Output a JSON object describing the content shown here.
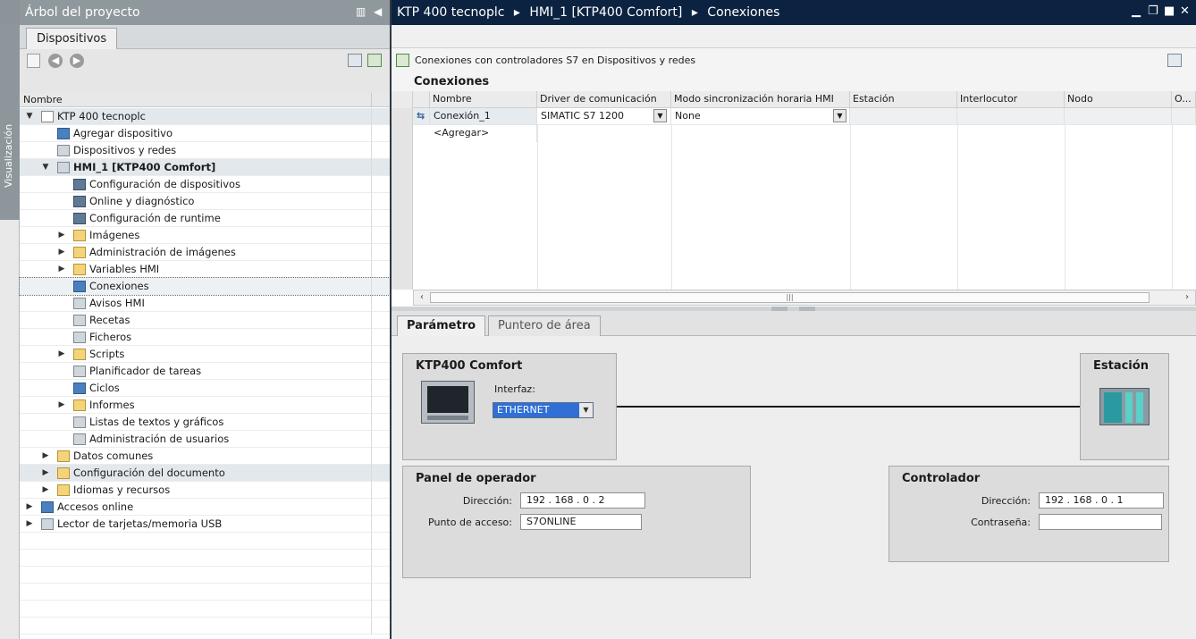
{
  "side_tab": {
    "label": "Visualización"
  },
  "left_panel": {
    "title": "Árbol del proyecto",
    "tab": "Dispositivos",
    "column_header": "Nombre",
    "tree": [
      {
        "label": "KTP 400 tecnoplc",
        "level": 0,
        "expanded": true,
        "icon": "page-icon"
      },
      {
        "label": "Agregar dispositivo",
        "level": 1,
        "icon": "add-device-icon"
      },
      {
        "label": "Dispositivos y redes",
        "level": 1,
        "icon": "network-icon"
      },
      {
        "label": "HMI_1 [KTP400 Comfort]",
        "level": 1,
        "expanded": true,
        "icon": "hmi-icon"
      },
      {
        "label": "Configuración de dispositivos",
        "level": 2,
        "icon": "device-config-icon"
      },
      {
        "label": "Online y diagnóstico",
        "level": 2,
        "icon": "diagnostics-icon"
      },
      {
        "label": "Configuración de runtime",
        "level": 2,
        "icon": "runtime-icon"
      },
      {
        "label": "Imágenes",
        "level": 2,
        "collapsed": true,
        "icon": "folder-icon"
      },
      {
        "label": "Administración de imágenes",
        "level": 2,
        "collapsed": true,
        "icon": "folder-icon"
      },
      {
        "label": "Variables HMI",
        "level": 2,
        "collapsed": true,
        "icon": "folder-icon"
      },
      {
        "label": "Conexiones",
        "level": 2,
        "icon": "connections-icon",
        "selected": true
      },
      {
        "label": "Avisos HMI",
        "level": 2,
        "icon": "alarm-icon"
      },
      {
        "label": "Recetas",
        "level": 2,
        "icon": "recipe-icon"
      },
      {
        "label": "Ficheros",
        "level": 2,
        "icon": "archive-icon"
      },
      {
        "label": "Scripts",
        "level": 2,
        "collapsed": true,
        "icon": "folder-icon"
      },
      {
        "label": "Planificador de tareas",
        "level": 2,
        "icon": "scheduler-icon"
      },
      {
        "label": "Ciclos",
        "level": 2,
        "icon": "cycle-icon"
      },
      {
        "label": "Informes",
        "level": 2,
        "collapsed": true,
        "icon": "folder-icon"
      },
      {
        "label": "Listas de textos y gráficos",
        "level": 2,
        "icon": "text-list-icon"
      },
      {
        "label": "Administración de usuarios",
        "level": 2,
        "icon": "users-icon"
      },
      {
        "label": "Datos comunes",
        "level": 1,
        "collapsed": true,
        "icon": "folder-icon"
      },
      {
        "label": "Configuración del documento",
        "level": 1,
        "collapsed": true,
        "icon": "folder-icon"
      },
      {
        "label": "Idiomas y recursos",
        "level": 1,
        "collapsed": true,
        "icon": "folder-icon"
      },
      {
        "label": "Accesos online",
        "level": 0,
        "collapsed": true,
        "icon": "online-icon"
      },
      {
        "label": "Lector de tarjetas/memoria USB",
        "level": 0,
        "collapsed": true,
        "icon": "usb-icon"
      }
    ]
  },
  "editor": {
    "breadcrumb": [
      "KTP 400 tecnoplc",
      "HMI_1 [KTP400 Comfort]",
      "Conexiones"
    ],
    "toolbar_text": "Conexiones con controladores S7 en Dispositivos y redes",
    "section_title": "Conexiones",
    "columns": [
      "Nombre",
      "Driver de comunicación",
      "Modo sincronización horaria HMI",
      "Estación",
      "Interlocutor",
      "Nodo",
      "O..."
    ],
    "rows": [
      {
        "nombre": "Conexión_1",
        "driver": "SIMATIC S7 1200",
        "modo": "None"
      }
    ],
    "add_row": "<Agregar>"
  },
  "inspector": {
    "tabs": [
      "Parámetro",
      "Puntero de área"
    ],
    "hmi_box": {
      "title": "KTP400 Comfort",
      "interface_label": "Interfaz:",
      "interface_value": "ETHERNET"
    },
    "station_box": {
      "title": "Estación"
    },
    "operator_panel": {
      "title": "Panel de operador",
      "address_label": "Dirección:",
      "address": "192 . 168 . 0    . 2",
      "access_point_label": "Punto de acceso:",
      "access_point": "S7ONLINE"
    },
    "controller": {
      "title": "Controlador",
      "address_label": "Dirección:",
      "address": "192 . 168 . 0    . 1",
      "password_label": "Contraseña:",
      "password": ""
    }
  },
  "colors": {
    "title_dark": "#0b2240",
    "title_gray": "#8f989d",
    "accent_blue": "#2f6fd6"
  }
}
